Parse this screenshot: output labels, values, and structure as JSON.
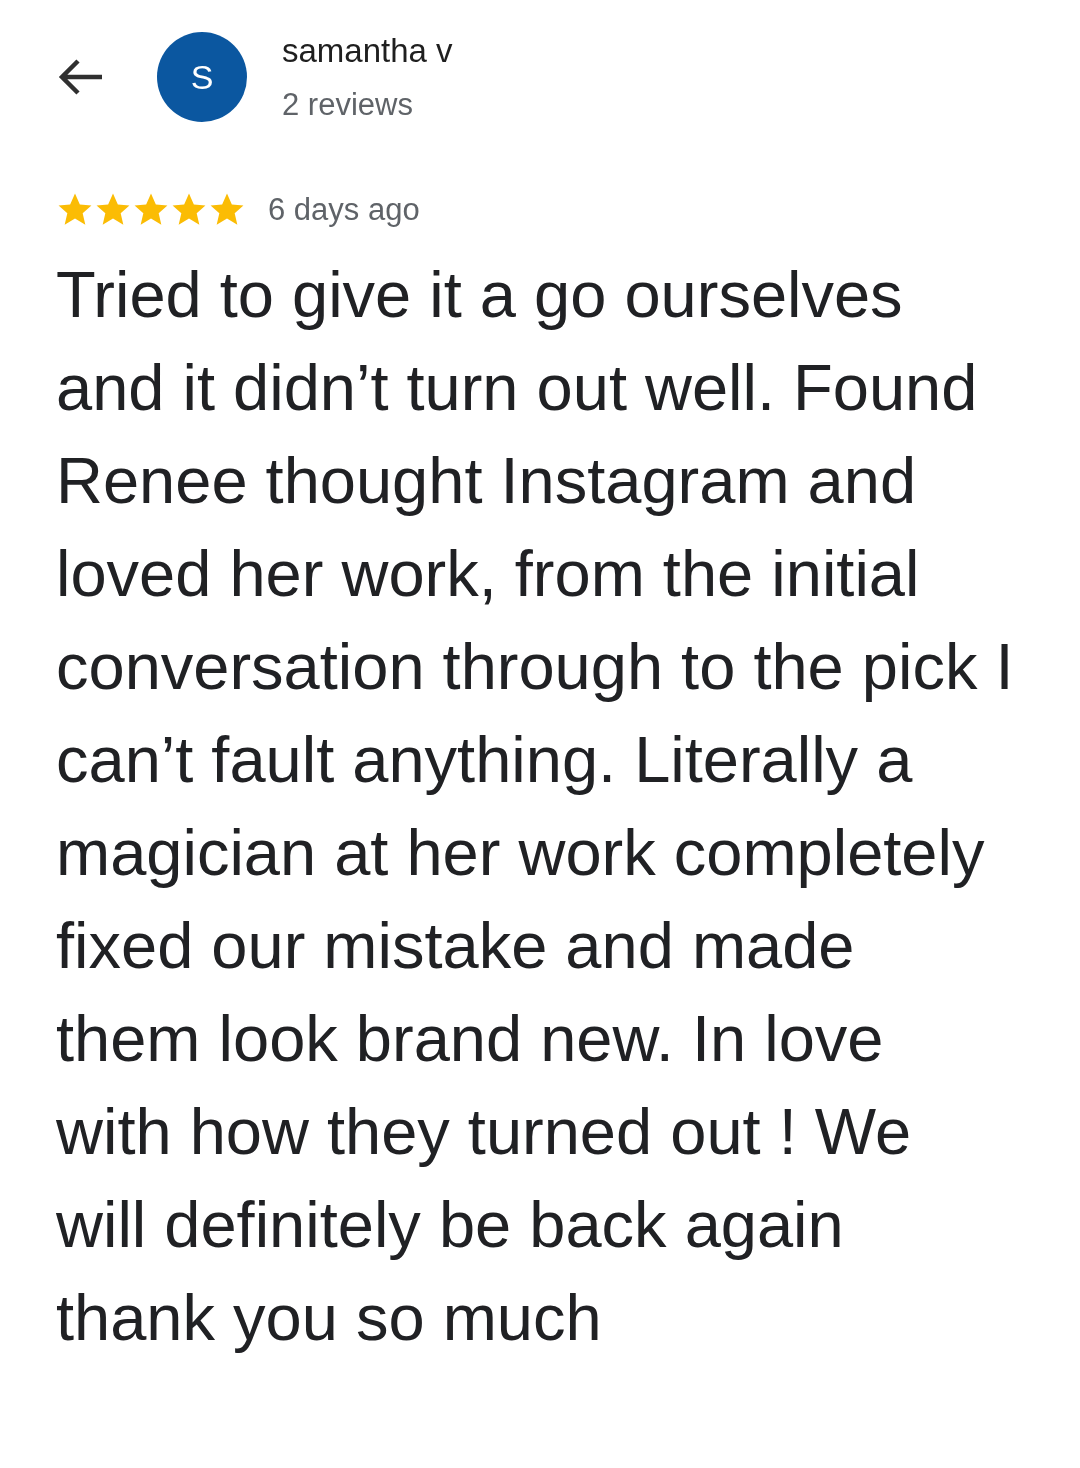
{
  "reviewer": {
    "avatar_letter": "S",
    "name": "samantha v",
    "review_count": "2 reviews"
  },
  "review": {
    "stars": 5,
    "time": "6 days ago",
    "text": "Tried to give it a go ourselves and it didn’t turn out well. Found Renee thought Instagram and loved her work, from the initial conversation through to the pick I can’t fault anything. Literally a magician at her work completely fixed our mistake and made them look brand new. In love with how they turned out ! We will definitely be back again thank you so much"
  }
}
